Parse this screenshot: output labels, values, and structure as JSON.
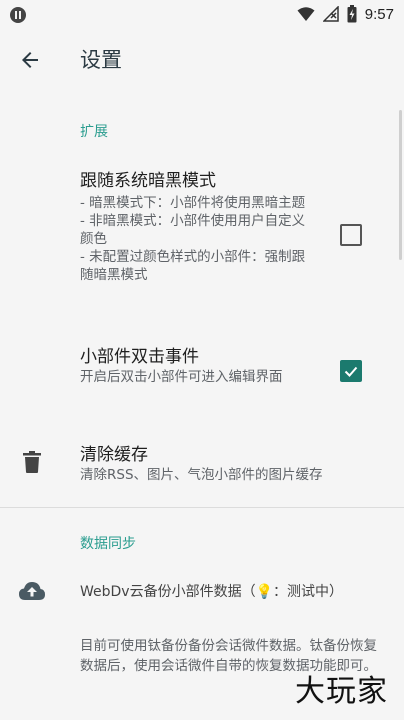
{
  "status_bar": {
    "time": "9:57",
    "icons": [
      "app-indicator-icon",
      "wifi-icon",
      "signal-off-icon",
      "battery-charging-icon"
    ]
  },
  "app_bar": {
    "title": "设置",
    "back_icon": "arrow-back-icon"
  },
  "section_extension": {
    "header": "扩展",
    "items": [
      {
        "title": "跟随系统暗黑模式",
        "summary": "- 暗黑模式下：小部件将使用黑暗主题\n- 非暗黑模式：小部件使用用户自定义颜色\n- 未配置过颜色样式的小部件：强制跟随暗黑模式",
        "checked": false
      },
      {
        "title": "小部件双击事件",
        "summary": "开启后双击小部件可进入编辑界面",
        "checked": true
      },
      {
        "title": "清除缓存",
        "summary": "清除RSS、图片、气泡小部件的图片缓存",
        "icon": "trash-icon"
      }
    ]
  },
  "section_sync": {
    "header": "数据同步",
    "webdav_text": "WebDv云备份小部件数据（💡：测试中）",
    "webdav_icon": "cloud-upload-icon",
    "info": "目前可使用钛备份备份会话微件数据。钛备份恢复数据后，使用会话微件自带的恢复数据功能即可。"
  },
  "watermark": "大玩家",
  "colors": {
    "accent": "#2a9d8f",
    "checkbox_checked": "#1b7a6e",
    "background": "#f5f5f5"
  }
}
